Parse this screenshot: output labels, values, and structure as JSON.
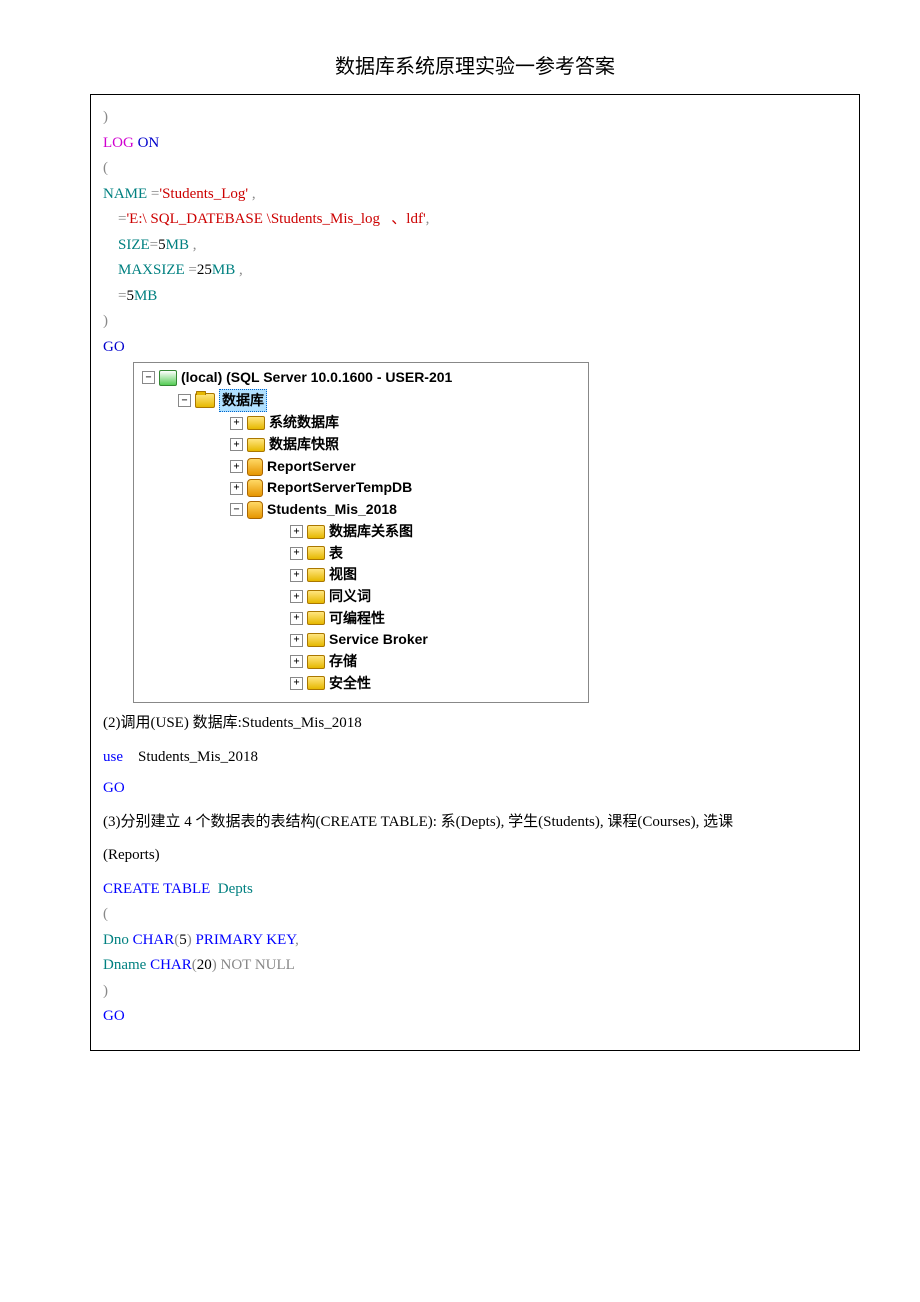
{
  "title": "数据库系统原理实验一参考答案",
  "sql_top": {
    "l1": ")",
    "l2a": "LOG",
    "l2b": " ON",
    "l3": "(",
    "l4a": "NAME",
    "l4b": " =",
    "l4c": "'Students_Log'",
    "l4d": " ,",
    "l5a": "    =",
    "l5b": "'E:\\ SQL_DATEBASE \\Students_Mis_log   、ldf'",
    "l5c": ",",
    "l6a": "    SIZE",
    "l6b": "=",
    "l6c": "5",
    "l6d": "MB",
    "l6e": " ,",
    "l7a": "    MAXSIZE",
    "l7b": " =",
    "l7c": "25",
    "l7d": "MB",
    "l7e": " ,",
    "l8a": "    =",
    "l8b": "5",
    "l8c": "MB",
    "l9": ")",
    "l10": "GO"
  },
  "tree": {
    "root": "(local) (SQL Server 10.0.1600 - USER-201",
    "databases": "数据库",
    "sysdb": "系统数据库",
    "snapshot": "数据库快照",
    "report": "ReportServer",
    "reporttemp": "ReportServerTempDB",
    "students": "Students_Mis_2018",
    "diagram": "数据库关系图",
    "tables": "表",
    "views": "视图",
    "synonyms": "同义词",
    "programmability": "可编程性",
    "servicebroker": "Service Broker",
    "storage": "存储",
    "security": "安全性"
  },
  "step2": {
    "text": "(2)调用(USE) 数据库:Students_Mis_2018",
    "use_a": "use",
    "use_b": "    Students_Mis_2018",
    "go": "GO"
  },
  "step3": {
    "text": "(3)分别建立 4 个数据表的表结构(CREATE      TABLE):  系(Depts), 学生(Students),  课程(Courses),  选课",
    "text2": "(Reports)"
  },
  "sql_create": {
    "l1a": "CREATE",
    "l1b": " TABLE",
    "l1c": "  Depts",
    "l2": "(",
    "l3a": "Dno ",
    "l3b": "CHAR",
    "l3c": "(",
    "l3d": "5",
    "l3e": ")",
    "l3f": " PRIMARY",
    "l3g": " KEY",
    "l3h": ",",
    "l4a": "Dname ",
    "l4b": "CHAR",
    "l4c": "(",
    "l4d": "20",
    "l4e": ")",
    "l4f": " NOT",
    "l4g": " NULL",
    "l5": ")",
    "l6": "GO"
  }
}
